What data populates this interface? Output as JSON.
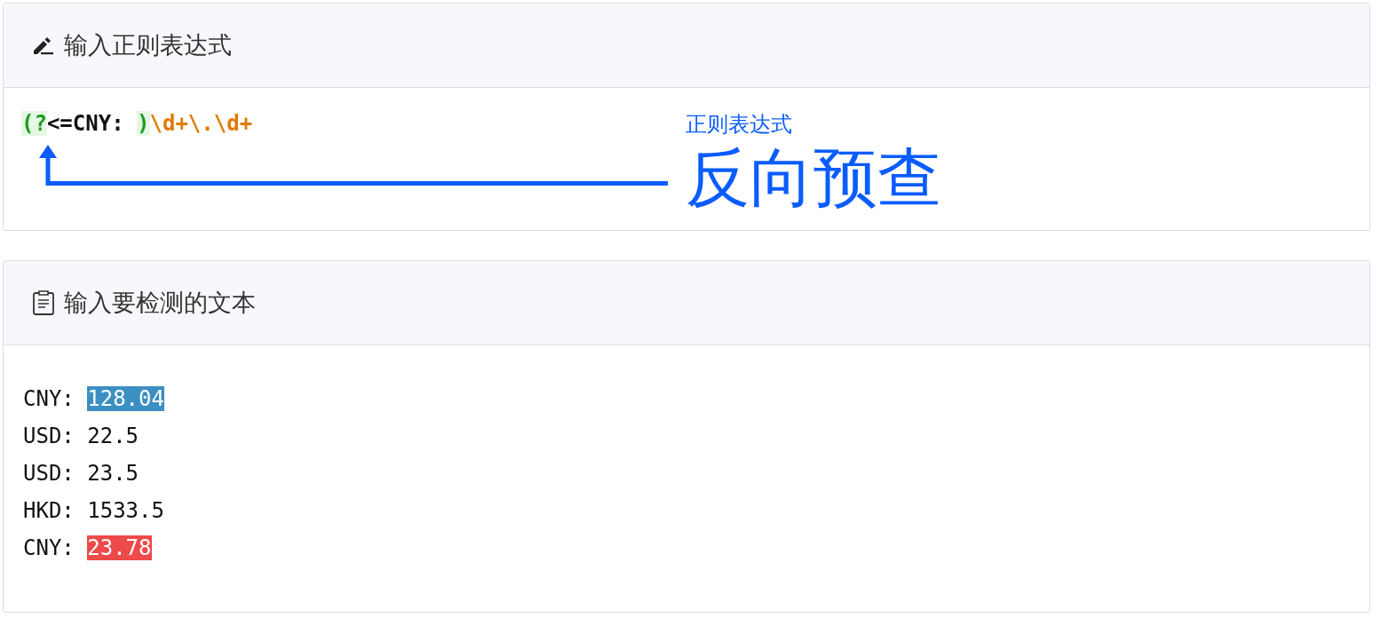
{
  "regex_panel": {
    "title": "输入正则表达式",
    "tokens": [
      {
        "text": "(?",
        "kind": "group"
      },
      {
        "text": "<=CNY: ",
        "kind": "literal"
      },
      {
        "text": ")",
        "kind": "group"
      },
      {
        "text": "\\d+\\.\\d+",
        "kind": "escape"
      }
    ],
    "annotation": {
      "caption": "正则表达式",
      "label": "反向预查"
    }
  },
  "text_panel": {
    "title": "输入要检测的文本",
    "lines": [
      {
        "text": "CNY: ",
        "match": "128.04",
        "color": "#3c8fc2"
      },
      {
        "text": "USD: 22.5"
      },
      {
        "text": "USD: 23.5"
      },
      {
        "text": "HKD: 1533.5"
      },
      {
        "text": "CNY: ",
        "match": "23.78",
        "color": "#ef4a4a"
      }
    ]
  }
}
